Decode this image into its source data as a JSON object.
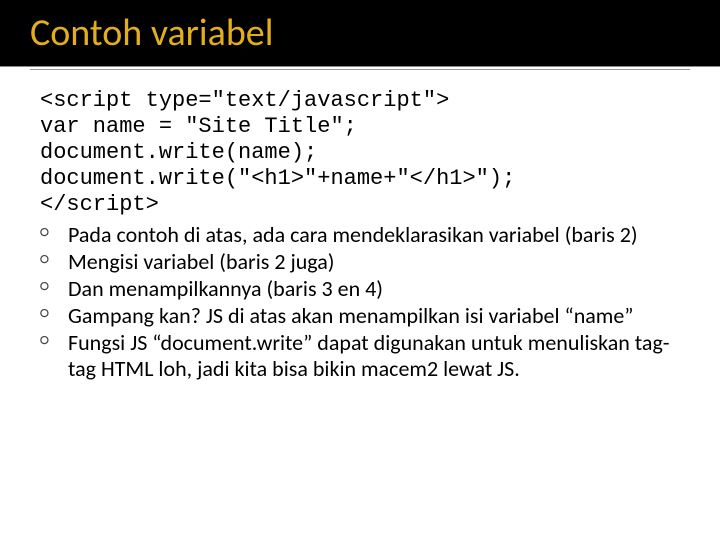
{
  "title": "Contoh variabel",
  "code": {
    "l1": "<script type=\"text/javascript\">",
    "l2": "var name = \"Site Title\";",
    "l3": "document.write(name);",
    "l4": "document.write(\"<h1>\"+name+\"</h1>\");",
    "l5_open": "</scr",
    "l5_close": "ipt>"
  },
  "bullets": {
    "b1": "Pada contoh di atas, ada cara mendeklarasikan variabel (baris 2)",
    "b2": "Mengisi variabel (baris 2 juga)",
    "b3": "Dan menampilkannya (baris 3 en 4)",
    "b4": "Gampang kan? JS di atas akan menampilkan isi variabel “name”",
    "b5": "Fungsi JS “document.write” dapat digunakan untuk menuliskan tag-tag HTML loh, jadi kita bisa bikin macem2 lewat JS."
  }
}
